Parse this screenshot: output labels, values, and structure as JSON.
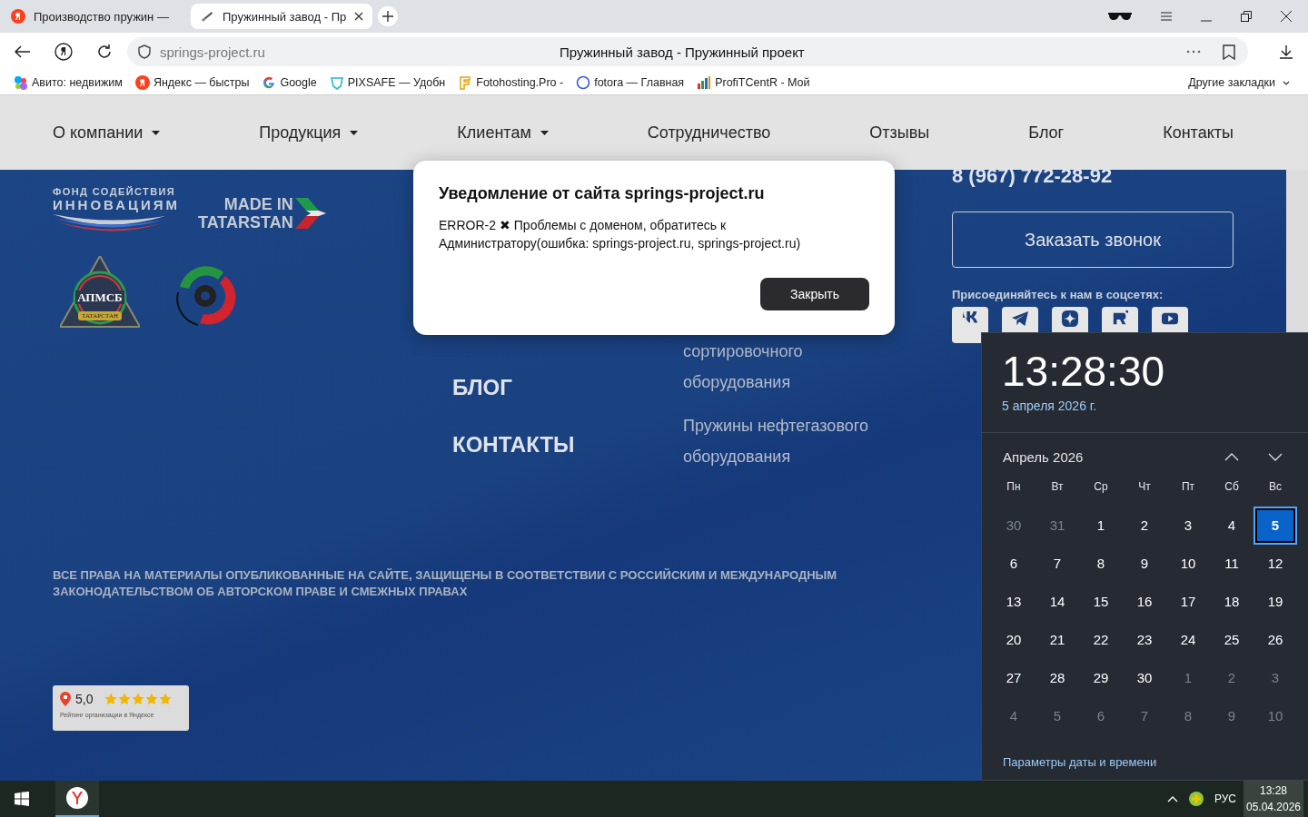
{
  "browser": {
    "tabs": [
      {
        "title": "Производство пружин —",
        "selected": false
      },
      {
        "title": "Пружинный завод - Пр",
        "selected": true
      }
    ],
    "address": {
      "url": "springs-project.ru",
      "page_title": "Пружинный завод - Пружинный проект"
    },
    "bookmarks": [
      {
        "kind": "avito",
        "label": "Авито: недвижим"
      },
      {
        "kind": "yandex",
        "label": "Яндекс — быстры"
      },
      {
        "kind": "google",
        "label": "Google"
      },
      {
        "kind": "pixsafe",
        "label": "PIXSAFE — Удобн"
      },
      {
        "kind": "fotohosting",
        "label": "Fotohosting.Pro -"
      },
      {
        "kind": "fotora",
        "label": "fotora — Главная"
      },
      {
        "kind": "chart",
        "label": "ProfiTCentR - Мой"
      }
    ],
    "other_bookmarks": "Другие закладки"
  },
  "site": {
    "nav": [
      {
        "label": "О компании",
        "dropdown": true
      },
      {
        "label": "Продукция",
        "dropdown": true
      },
      {
        "label": "Клиентам",
        "dropdown": true
      },
      {
        "label": "Сотрудничество",
        "dropdown": false
      },
      {
        "label": "Отзывы",
        "dropdown": false
      },
      {
        "label": "Блог",
        "dropdown": false
      },
      {
        "label": "Контакты",
        "dropdown": false
      }
    ],
    "footer": {
      "logos": {
        "fund": [
          "ФОНД СОДЕЙСТВИЯ",
          "ИННОВАЦИЯМ"
        ],
        "made_in": [
          "MADE IN",
          "TATARSTAN"
        ],
        "association": [
          "АПМСБ",
          "ТАТАРСТАН"
        ]
      },
      "menu": [
        "БЛОГ",
        "КОНТАКТЫ"
      ],
      "products": [
        "сортировочного оборудования",
        "Пружины нефтегазового оборудования"
      ],
      "phone": "8 (967) 772-28-92",
      "callback_button": "Заказать звонок",
      "social_heading": "Присоединяйтесь к нам в соцсетях:",
      "social": [
        {
          "kind": "vk"
        },
        {
          "kind": "telegram"
        },
        {
          "kind": "zen"
        },
        {
          "kind": "rutube"
        },
        {
          "kind": "youtube"
        }
      ],
      "copyright": "ВСЕ ПРАВА НА МАТЕРИАЛЫ ОПУБЛИКОВАННЫЕ НА САЙТЕ, ЗАЩИЩЕНЫ В СООТВЕТСТВИИ С РОССИЙСКИМ И МЕЖДУНАРОДНЫМ ЗАКОНОДАТЕЛЬСТВОМ ОБ АВТОРСКОМ ПРАВЕ И СМЕЖНЫХ ПРАВАХ",
      "rating": {
        "score": "5,0",
        "stars": 5,
        "caption": "Рейтинг организации в Яндексе"
      }
    }
  },
  "dialog": {
    "title": "Уведомление от сайта springs-project.ru",
    "message": "ERROR-2 ✖ Проблемы с доменом, обратитесь к Администратору(ошибка: springs-project.ru, springs-project.ru)",
    "button": "Закрыть"
  },
  "calendar": {
    "time": "13:28:30",
    "date": "5 апреля 2026 г.",
    "month": "Апрель 2026",
    "weekdays": [
      "Пн",
      "Вт",
      "Ср",
      "Чт",
      "Пт",
      "Сб",
      "Вс"
    ],
    "days": [
      {
        "label": "30",
        "in_month": false,
        "selected": false
      },
      {
        "label": "31",
        "in_month": false,
        "selected": false
      },
      {
        "label": "1",
        "in_month": true,
        "selected": false
      },
      {
        "label": "2",
        "in_month": true,
        "selected": false
      },
      {
        "label": "3",
        "in_month": true,
        "selected": false
      },
      {
        "label": "4",
        "in_month": true,
        "selected": false
      },
      {
        "label": "5",
        "in_month": true,
        "selected": true
      },
      {
        "label": "6",
        "in_month": true,
        "selected": false
      },
      {
        "label": "7",
        "in_month": true,
        "selected": false
      },
      {
        "label": "8",
        "in_month": true,
        "selected": false
      },
      {
        "label": "9",
        "in_month": true,
        "selected": false
      },
      {
        "label": "10",
        "in_month": true,
        "selected": false
      },
      {
        "label": "11",
        "in_month": true,
        "selected": false
      },
      {
        "label": "12",
        "in_month": true,
        "selected": false
      },
      {
        "label": "13",
        "in_month": true,
        "selected": false
      },
      {
        "label": "14",
        "in_month": true,
        "selected": false
      },
      {
        "label": "15",
        "in_month": true,
        "selected": false
      },
      {
        "label": "16",
        "in_month": true,
        "selected": false
      },
      {
        "label": "17",
        "in_month": true,
        "selected": false
      },
      {
        "label": "18",
        "in_month": true,
        "selected": false
      },
      {
        "label": "19",
        "in_month": true,
        "selected": false
      },
      {
        "label": "20",
        "in_month": true,
        "selected": false
      },
      {
        "label": "21",
        "in_month": true,
        "selected": false
      },
      {
        "label": "22",
        "in_month": true,
        "selected": false
      },
      {
        "label": "23",
        "in_month": true,
        "selected": false
      },
      {
        "label": "24",
        "in_month": true,
        "selected": false
      },
      {
        "label": "25",
        "in_month": true,
        "selected": false
      },
      {
        "label": "26",
        "in_month": true,
        "selected": false
      },
      {
        "label": "27",
        "in_month": true,
        "selected": false
      },
      {
        "label": "28",
        "in_month": true,
        "selected": false
      },
      {
        "label": "29",
        "in_month": true,
        "selected": false
      },
      {
        "label": "30",
        "in_month": true,
        "selected": false
      },
      {
        "label": "1",
        "in_month": false,
        "selected": false
      },
      {
        "label": "2",
        "in_month": false,
        "selected": false
      },
      {
        "label": "3",
        "in_month": false,
        "selected": false
      },
      {
        "label": "4",
        "in_month": false,
        "selected": false
      },
      {
        "label": "5",
        "in_month": false,
        "selected": false
      },
      {
        "label": "6",
        "in_month": false,
        "selected": false
      },
      {
        "label": "7",
        "in_month": false,
        "selected": false
      },
      {
        "label": "8",
        "in_month": false,
        "selected": false
      },
      {
        "label": "9",
        "in_month": false,
        "selected": false
      },
      {
        "label": "10",
        "in_month": false,
        "selected": false
      }
    ],
    "settings_link": "Параметры даты и времени"
  },
  "taskbar": {
    "apps": [
      {
        "kind": "yandex",
        "active": true
      }
    ],
    "language": "РУС",
    "time": "13:28",
    "date": "05.04.2026"
  }
}
